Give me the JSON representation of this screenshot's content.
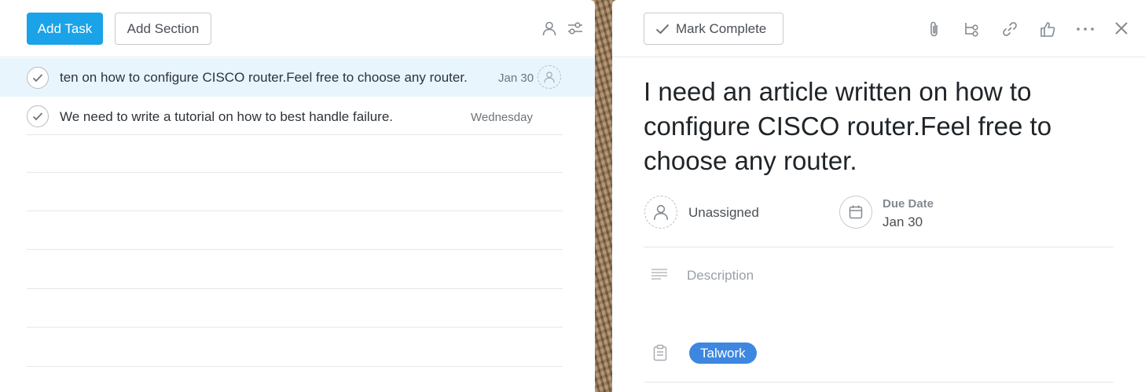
{
  "task_list": {
    "add_task_label": "Add Task",
    "add_section_label": "Add Section",
    "tasks": [
      {
        "title": "ten on how to configure CISCO router.Feel free to choose any router.",
        "due": "Jan 30"
      },
      {
        "title": "We need to write a tutorial on how to best handle failure.",
        "due": "Wednesday"
      }
    ]
  },
  "detail": {
    "mark_complete_label": "Mark Complete",
    "title": "I need an article written on how to configure CISCO router.Feel free to choose any router.",
    "assignee": "Unassigned",
    "due_label": "Due Date",
    "due_value": "Jan 30",
    "description_placeholder": "Description",
    "project_tag": "Talwork"
  },
  "colors": {
    "primary": "#1aa3e8",
    "selected_row": "#e8f5fd",
    "tag": "#3d87e0"
  }
}
